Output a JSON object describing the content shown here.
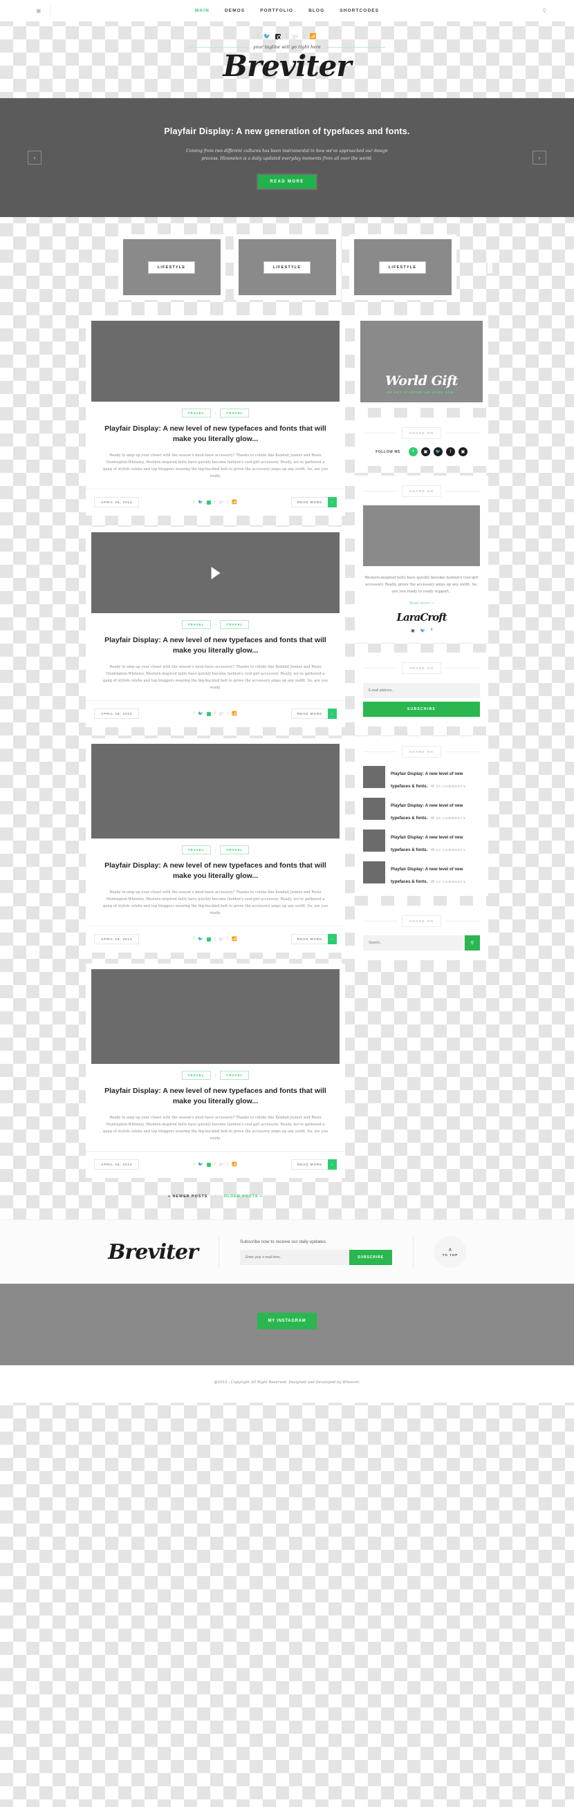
{
  "topbar": {
    "left_icon": "instagram-icon",
    "nav": [
      {
        "label": "MAIN",
        "active": true
      },
      {
        "label": "DEMOS",
        "active": false
      },
      {
        "label": "PORTFOLIO",
        "active": false
      },
      {
        "label": "BLOG",
        "active": false
      },
      {
        "label": "SHORTCODES",
        "active": false
      }
    ],
    "search_icon": "search-icon"
  },
  "branding": {
    "social": [
      "facebook",
      "twitter",
      "instagram",
      "pinterest",
      "google-plus",
      "tumblr",
      "rss"
    ],
    "tagline": "your tagline will go right here",
    "logo": "Breviter"
  },
  "hero": {
    "title": "Playfair Display: A new generation of typefaces and fonts.",
    "subtitle": "Coming from two different cultures has been instrumental in how we've approached our design process. Himmelen is a daily updated everyday moments from all over the world.",
    "button": "READ MORE",
    "prev": "‹",
    "next": "›"
  },
  "categories": [
    {
      "label": "LIFESTYLE"
    },
    {
      "label": "LIFESTYLE"
    },
    {
      "label": "LIFESTYLE"
    }
  ],
  "posts": [
    {
      "type": "image",
      "tags": [
        "TRAVEL",
        "TRAVEL"
      ],
      "title": "Playfair Display: A new level of new typefaces and fonts that will make you literally glow...",
      "excerpt": "Ready to amp up your closet with the season's must-have accessory? Thanks to celebs like Kendall Jenner and Rosie Huntington-Whiteley, Western-inspired belts have quickly become fashion's cool-girl accessory. Really, we've gathered a gang of stylish celebs and top bloggers wearing the big-buckled belt to prove the accessory amps up any outfit. So, are you ready.",
      "date": "APRIL 28, 2014",
      "readmore": "READ MORE"
    },
    {
      "type": "video",
      "tags": [
        "TRAVEL",
        "TRAVEL"
      ],
      "title": "Playfair Display: A new level of new typefaces and fonts that will make you literally glow...",
      "excerpt": "Ready to amp up your closet with the season's must-have accessory? Thanks to celebs like Kendall Jenner and Rosie Huntington-Whiteley, Western-inspired belts have quickly become fashion's cool-girl accessory. Really, we've gathered a gang of stylish celebs and top bloggers wearing the big-buckled belt to prove the accessory amps up any outfit. So, are you ready.",
      "date": "APRIL 28, 2014",
      "readmore": "READ MORE"
    },
    {
      "type": "image",
      "tags": [
        "TRAVEL",
        "TRAVEL"
      ],
      "title": "Playfair Display: A new level of new typefaces and fonts that will make you literally glow...",
      "excerpt": "Ready to amp up your closet with the season's must-have accessory? Thanks to celebs like Kendall Jenner and Rosie Huntington-Whiteley, Western-inspired belts have quickly become fashion's cool-girl accessory. Really, we've gathered a gang of stylish celebs and top bloggers wearing the big-buckled belt to prove the accessory amps up any outfit. So, are you ready.",
      "date": "APRIL 28, 2014",
      "readmore": "READ MORE"
    },
    {
      "type": "image",
      "tags": [
        "TRAVEL",
        "TRAVEL"
      ],
      "title": "Playfair Display: A new level of new typefaces and fonts that will make you literally glow...",
      "excerpt": "Ready to amp up your closet with the season's must-have accessory? Thanks to celebs like Kendall Jenner and Rosie Huntington-Whiteley, Western-inspired belts have quickly become fashion's cool-girl accessory. Really, we've gathered a gang of stylish celebs and top bloggers wearing the big-buckled belt to prove the accessory amps up any outfit. So, are you ready.",
      "date": "APRIL 28, 2014",
      "readmore": "READ MORE"
    }
  ],
  "pagination": {
    "newer": "« NEWER POSTS",
    "separator": "/",
    "older": "OLDER POSTS »"
  },
  "sidebar": {
    "widget_title": "SHARE ON",
    "promo": {
      "script": "World Gift",
      "sub": "OR GET STARTED ON SOME JOB.."
    },
    "follow": {
      "label": "FOLLOW ME",
      "caret": "›",
      "icons": [
        "pinterest",
        "instagram",
        "twitter",
        "facebook",
        "instagram"
      ]
    },
    "about": {
      "text": "Western-inspired belts have quickly become fashion's cool-girl accessory. Really, prove the accessory amps up any outfit. So, are you ready to really support..",
      "readmore": "Read more →",
      "signature": "LaraCroft",
      "social": [
        "instagram",
        "twitter",
        "facebook"
      ]
    },
    "newsletter": {
      "placeholder": "E-mail address..",
      "button": "SUBSCRIBE"
    },
    "popular": [
      {
        "title": "Playfair Display: A new level of new typefaces & fonts.",
        "comments": "23 COMMENTS"
      },
      {
        "title": "Playfair Display: A new level of new typefaces & fonts.",
        "comments": "23 COMMENTS"
      },
      {
        "title": "Playfair Display: A new level of new typefaces & fonts.",
        "comments": "23 COMMENTS"
      },
      {
        "title": "Playfair Display: A new level of new typefaces & fonts.",
        "comments": "23 COMMENTS"
      }
    ],
    "search": {
      "placeholder": "Search..",
      "icon": "search-icon"
    }
  },
  "footer": {
    "logo": "Breviter",
    "subscribe_label": "Subscribe now to receive our daily updates.",
    "input_placeholder": "Enter your e-mail here..",
    "button": "SUBSCRIBE",
    "to_top_caret": "∧",
    "to_top_label": "TO TOP",
    "instagram_button": "MY INSTAGRAM",
    "copyright": "@2015 - Copyright All Right Reserved. Designed and Developed by Whoever."
  },
  "colors": {
    "accent_green": "#2ecc71",
    "button_green": "#2ab74f",
    "hero_bg": "#5b5b5b",
    "placeholder_gray": "#8a8a8a"
  }
}
